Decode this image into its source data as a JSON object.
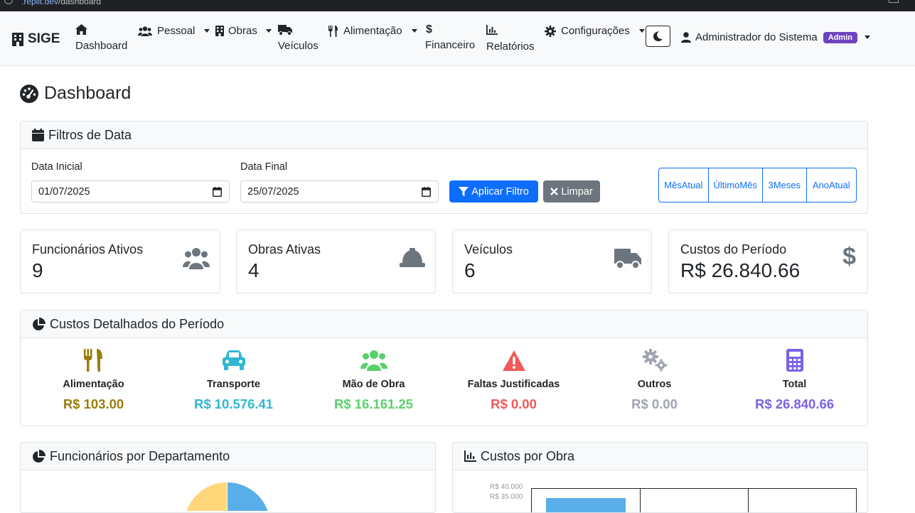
{
  "browser": {
    "url_host": ".replit.dev",
    "url_path": "/dashboard"
  },
  "nav": {
    "brand": "SIGE",
    "items": [
      {
        "label": "Dashboard",
        "icon": "home-icon"
      },
      {
        "label": "Pessoal",
        "icon": "users-icon",
        "dropdown": true
      },
      {
        "label": "Obras",
        "icon": "building-icon",
        "dropdown": true
      },
      {
        "label": "Veículos",
        "icon": "truck-icon"
      },
      {
        "label": "Alimentação",
        "icon": "utensils-icon",
        "dropdown": true
      },
      {
        "label": "Financeiro",
        "icon": "dollar-icon"
      },
      {
        "label": "Relatórios",
        "icon": "chart-icon"
      },
      {
        "label": "Configurações",
        "icon": "gear-icon",
        "dropdown": true
      }
    ],
    "user_name": "Administrador do Sistema",
    "user_badge": "Admin"
  },
  "page": {
    "title": "Dashboard"
  },
  "filters": {
    "header": "Filtros de Data",
    "start_label": "Data Inicial",
    "start_value": "01/07/2025",
    "end_label": "Data Final",
    "end_value": "25/07/2025",
    "apply_label": "Aplicar Filtro",
    "clear_label": "Limpar",
    "quick": [
      {
        "line1": "Mês",
        "line2": "Atual"
      },
      {
        "line1": "Último",
        "line2": "Mês"
      },
      {
        "line1": "3",
        "line2": "Meses"
      },
      {
        "line1": "Ano",
        "line2": "Atual"
      }
    ]
  },
  "stats": [
    {
      "title": "Funcionários Ativos",
      "value": "9",
      "icon": "users-icon"
    },
    {
      "title": "Obras Ativas",
      "value": "4",
      "icon": "hard-hat-icon"
    },
    {
      "title": "Veículos",
      "value": "6",
      "icon": "truck-icon"
    },
    {
      "title": "Custos do Período",
      "value": "R$ 26.840.66",
      "icon": "dollar-icon"
    }
  ],
  "costs": {
    "header": "Custos Detalhados do Período",
    "items": [
      {
        "label": "Alimentação",
        "value": "R$ 103.00",
        "color": "#9a7d0a",
        "icon": "utensils-icon"
      },
      {
        "label": "Transporte",
        "value": "R$ 10.576.41",
        "color": "#31b7d3",
        "icon": "car-icon"
      },
      {
        "label": "Mão de Obra",
        "value": "R$ 16.161.25",
        "color": "#5ad06b",
        "icon": "users-icon"
      },
      {
        "label": "Faltas Justificadas",
        "value": "R$ 0.00",
        "color": "#ef5a5a",
        "icon": "warning-icon"
      },
      {
        "label": "Outros",
        "value": "R$ 0.00",
        "color": "#a0a4ad",
        "icon": "gears-icon"
      },
      {
        "label": "Total",
        "value": "R$ 26.840.66",
        "color": "#7b61e6",
        "icon": "calculator-icon"
      }
    ]
  },
  "dept_card": {
    "header": "Funcionários por Departamento"
  },
  "obra_card": {
    "header": "Custos por Obra",
    "y_ticks": [
      "R$ 40.000",
      "R$ 35.000"
    ]
  },
  "colors": {
    "primary": "#0d6efd",
    "secondary": "#6c757d",
    "admin_badge": "#6f42c1"
  }
}
